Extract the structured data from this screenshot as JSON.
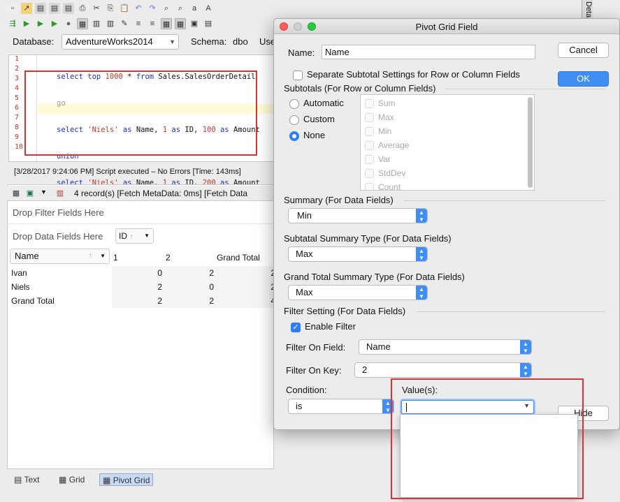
{
  "toolbar": {
    "db_label": "Database:",
    "db_value": "AdventureWorks2014",
    "schema_label": "Schema:",
    "schema_value": "dbo",
    "user_label": "Use",
    "right_tab": "Detai"
  },
  "editor": {
    "lines": [
      "1",
      "2",
      "3",
      "4",
      "5",
      "6",
      "7",
      "8",
      "9",
      "10"
    ],
    "status": "[3/28/2017 9:24:06 PM] Script executed – No Errors [Time: 143ms]"
  },
  "results": {
    "info": "4 record(s) [Fetch MetaData: 0ms] [Fetch Data",
    "drop_filter": "Drop Filter Fields Here",
    "drop_data": "Drop Data Fields Here",
    "id_field": "ID",
    "name_field": "Name",
    "col_headers": [
      "1",
      "2",
      "Grand Total"
    ],
    "rows": [
      {
        "label": "Ivan",
        "v": [
          "0",
          "2",
          "2"
        ]
      },
      {
        "label": "Niels",
        "v": [
          "2",
          "0",
          "2"
        ]
      },
      {
        "label": "Grand Total",
        "v": [
          "2",
          "2",
          "4"
        ]
      }
    ],
    "tabs": [
      "Text",
      "Grid",
      "Pivot Grid"
    ]
  },
  "dialog": {
    "title": "Pivot Grid Field",
    "name_label": "Name:",
    "name_value": "Name",
    "cancel": "Cancel",
    "ok": "OK",
    "hide": "Hide",
    "separate": "Separate Subtotal Settings for Row or Column Fields",
    "subtotals_label": "Subtotals (For Row or Column Fields)",
    "radios": [
      "Automatic",
      "Custom",
      "None"
    ],
    "functions": [
      "Sum",
      "Max",
      "Min",
      "Average",
      "Var",
      "StdDev",
      "Count"
    ],
    "summary_label": "Summary (For Data Fields)",
    "summary_value": "Min",
    "subtotal_summary_label": "Subtatal Summary Type (For Data Fields)",
    "subtotal_summary_value": "Max",
    "grand_total_label": "Grand Total Summary Type (For Data Fields)",
    "grand_total_value": "Max",
    "filter_setting_label": "Filter Setting (For Data Fields)",
    "enable_filter": "Enable Filter",
    "filter_field_label": "Filter On Field:",
    "filter_field_value": "Name",
    "filter_key_label": "Filter On Key:",
    "filter_key_value": "2",
    "condition_label": "Condition:",
    "condition_value": "is",
    "values_label": "Value(s):"
  },
  "colors": {
    "accent": "#3f8ef3",
    "highlight": "#e03030"
  }
}
